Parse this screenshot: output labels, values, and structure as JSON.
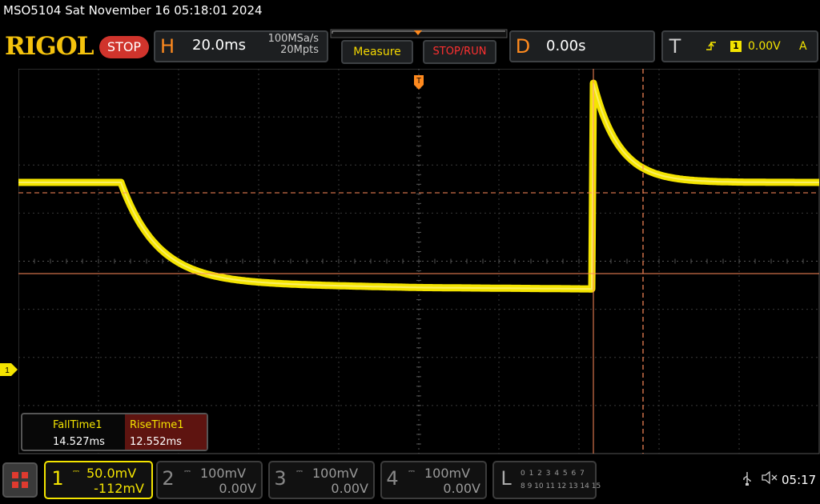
{
  "title": "MSO5104  Sat November 16 05:18:01 2024",
  "brand": "RIGOL",
  "run_state": "STOP",
  "horizontal": {
    "letter": "H",
    "timebase": "20.0ms",
    "sample_rate": "100MSa/s",
    "memory_depth": "20Mpts"
  },
  "buttons": {
    "measure": "Measure",
    "stop_run": "STOP/RUN"
  },
  "delay": {
    "letter": "D",
    "value": "0.00s"
  },
  "trigger": {
    "letter": "T",
    "channel": "1",
    "level": "0.00V",
    "mode": "A"
  },
  "measurements": {
    "fall_label": "FallTime1",
    "fall_value": "14.527ms",
    "rise_label": "RiseTime1",
    "rise_value": "12.552ms"
  },
  "channel_marker": "1",
  "channels": [
    {
      "num": "1",
      "scale": "50.0mV",
      "offset": "-112mV"
    },
    {
      "num": "2",
      "scale": "100mV",
      "offset": "0.00V"
    },
    {
      "num": "3",
      "scale": "100mV",
      "offset": "0.00V"
    },
    {
      "num": "4",
      "scale": "100mV",
      "offset": "0.00V"
    }
  ],
  "logic": {
    "letter": "L",
    "row1": "0 1 2 3  4 5 6 7",
    "row2": "8 9 10 11 12 13 14 15"
  },
  "clock": "05:17",
  "colors": {
    "trace": "#f4e400",
    "cursor": "#ff8a5a",
    "accent": "#ff8a1e",
    "stop": "#d0342c"
  }
}
